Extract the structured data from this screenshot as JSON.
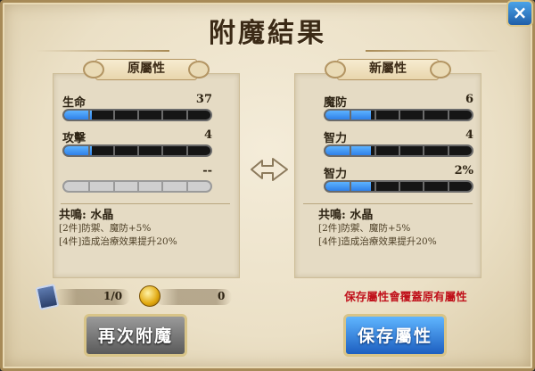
{
  "title": "附魔結果",
  "close_label": "×",
  "original": {
    "banner": "原屬性",
    "stats": [
      {
        "name": "生命",
        "value": "37",
        "fill": 0.19
      },
      {
        "name": "攻擊",
        "value": "4",
        "fill": 0.19
      },
      {
        "name": "",
        "value": "--",
        "fill": 0
      }
    ],
    "resonance": {
      "head": "共鳴: 水晶",
      "lines": [
        "[2件]防禦、魔防+5%",
        "[4件]造成治療效果提升20%"
      ]
    }
  },
  "new": {
    "banner": "新屬性",
    "stats": [
      {
        "name": "魔防",
        "value": "6",
        "fill": 0.31
      },
      {
        "name": "智力",
        "value": "4",
        "fill": 0.31
      },
      {
        "name": "智力",
        "value": "2%",
        "fill": 0.31
      }
    ],
    "resonance": {
      "head": "共鳴: 水晶",
      "lines": [
        "[2件]防禦、魔防+5%",
        "[4件]造成治療效果提升20%"
      ]
    }
  },
  "cost": {
    "ticket": "1/0",
    "gold": "0"
  },
  "warning": "保存屬性會覆蓋原有屬性",
  "buttons": {
    "again": "再次附魔",
    "save": "保存屬性"
  },
  "colors": {
    "bar_fill": "#2f80e8",
    "warning": "#c0111b",
    "save_button": "#2a7be0"
  }
}
